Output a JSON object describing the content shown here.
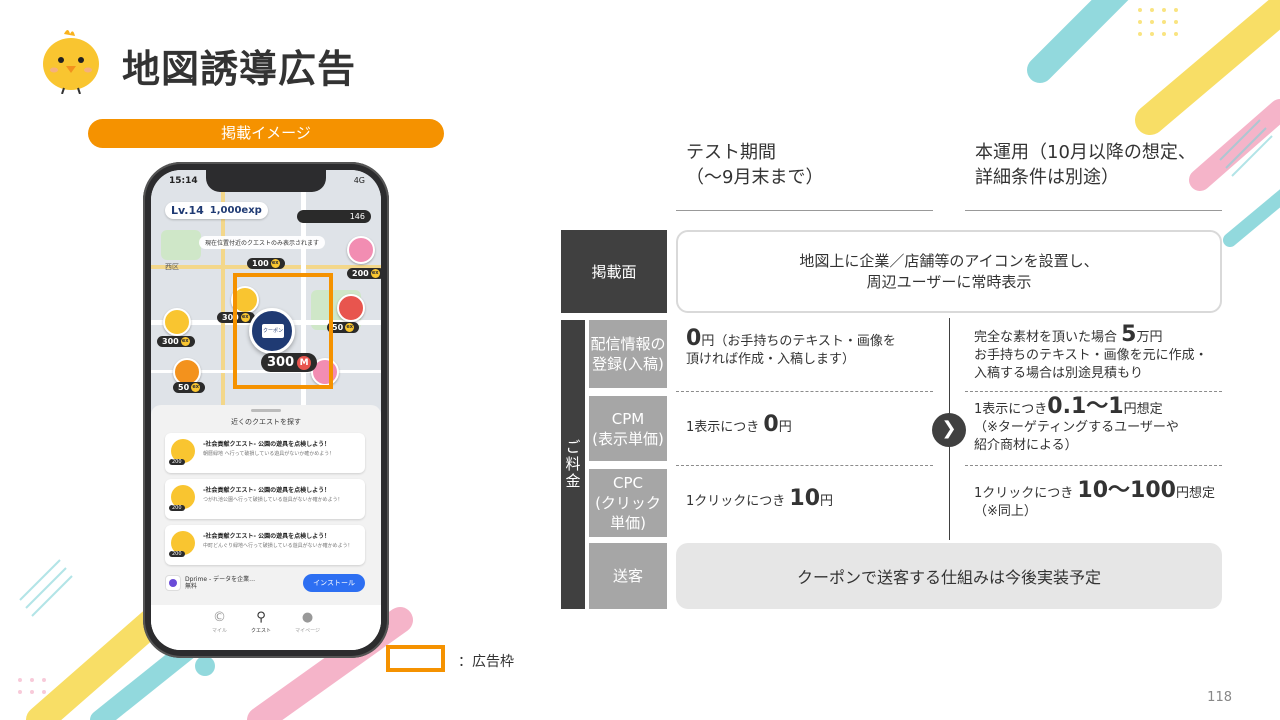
{
  "title": "地図誘導広告",
  "image_label": "掲載イメージ",
  "legend": "：広告枠",
  "page_number": "118",
  "phone": {
    "time": "15:14",
    "network": "4G",
    "level": "Lv.14",
    "exp": "1,000exp",
    "coins": "146",
    "notice": "現在位置付近のクエストのみ表示されます",
    "area_label": "西区",
    "ad_icon_text": "クーポン",
    "ad_price": "300",
    "ad_price_badge": "M",
    "pin_prices": [
      "100",
      "200",
      "300",
      "50",
      "300",
      "50"
    ],
    "sheet_title": "近くのクエストを探す",
    "quests": [
      {
        "title": "-社会貢献クエスト- 公園の遊具を点検しよう！",
        "desc": "朝暦緑地 へ行って破損している遊具がないか確かめよう！",
        "points": "200"
      },
      {
        "title": "-社会貢献クエスト- 公園の遊具を点検しよう！",
        "desc": "つがれ池公園へ行って破損している遊具がないか確かめよう！",
        "points": "200"
      },
      {
        "title": "-社会貢献クエスト- 公園の遊具を点検しよう！",
        "desc": "中町どんぐり緑地へ行って破損している遊具がないか確かめよう！",
        "points": "200"
      }
    ],
    "ad_app_name": "Dprime - データを企業…",
    "ad_app_sub": "無料",
    "install_label": "インストール",
    "tabs": [
      {
        "icon": "copyright-icon",
        "label": "マイル"
      },
      {
        "icon": "location-pin-icon",
        "label": "クエスト"
      },
      {
        "icon": "person-icon",
        "label": "マイページ"
      }
    ]
  },
  "columns": {
    "test_line1": "テスト期間",
    "test_line2": "（〜9月末まで）",
    "main_line1": "本運用（10月以降の想定、",
    "main_line2": "詳細条件は別途）"
  },
  "rows": {
    "placement_label": "掲載面",
    "placement_line1": "地図上に企業／店舗等のアイコンを設置し、",
    "placement_line2": "周辺ユーザーに常時表示",
    "fee_label": "ご料金",
    "register_label_1": "配信情報の",
    "register_label_2": "登録(入稿)",
    "register_test_big": "0",
    "register_test_unit": "円（お手持ちのテキスト・画像を",
    "register_test_line2": "頂ければ作成・入稿します）",
    "register_main_pre": "完全な素材を頂いた場合 ",
    "register_main_big": "5",
    "register_main_unit": "万円",
    "register_main_line2": "お手持ちのテキスト・画像を元に作成・",
    "register_main_line3": "入稿する場合は別途見積もり",
    "cpm_label_1": "CPM",
    "cpm_label_2": "(表示単価)",
    "cpm_test_pre": "1表示につき ",
    "cpm_test_big": "0",
    "cpm_test_unit": "円",
    "cpm_main_pre": "1表示につき",
    "cpm_main_big": "0.1〜1",
    "cpm_main_unit": "円想定",
    "cpm_main_line2": "（※ターゲティングするユーザーや",
    "cpm_main_line3": "紹介商材による）",
    "cpc_label_1": "CPC",
    "cpc_label_2": "(クリック単価)",
    "cpc_test_pre": "1クリックにつき ",
    "cpc_test_big": "10",
    "cpc_test_unit": "円",
    "cpc_main_pre": "1クリックにつき ",
    "cpc_main_big": "10〜100",
    "cpc_main_unit": "円想定",
    "cpc_main_line2": "（※同上）",
    "send_label": "送客",
    "send_text": "クーポンで送客する仕組みは今後実装予定"
  },
  "colors": {
    "accent_orange": "#f59200",
    "dark_gray": "#404040",
    "mid_gray": "#a6a6a6",
    "deco_teal": "#7fd3d8",
    "deco_yellow": "#f7d94c",
    "deco_pink": "#f4a7c0"
  }
}
